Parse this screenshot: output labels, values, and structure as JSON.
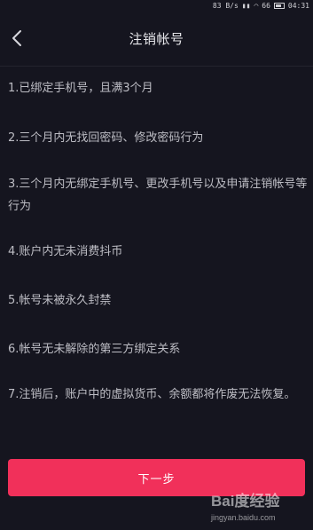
{
  "status_bar": {
    "net_speed": "83 B/s",
    "time": "04:31",
    "battery_label": "66"
  },
  "header": {
    "title": "注销帐号",
    "back_icon": "chevron-left-icon"
  },
  "rules": [
    "1.已绑定手机号，且满3个月",
    "2.三个月内无找回密码、修改密码行为",
    "3.三个月内无绑定手机号、更改手机号以及申请注销帐号等行为",
    "4.账户内无未消费抖币",
    "5.帐号未被永久封禁",
    "6.帐号无未解除的第三方绑定关系",
    "7.注销后，账户中的虚拟货币、余额都将作废无法恢复。"
  ],
  "footer": {
    "next_label": "下一步"
  },
  "watermark": {
    "logo": "Bai度经验",
    "url": "jingyan.baidu.com"
  },
  "colors": {
    "background": "#15151f",
    "accent": "#f1305a",
    "text": "#bdbdc4"
  }
}
